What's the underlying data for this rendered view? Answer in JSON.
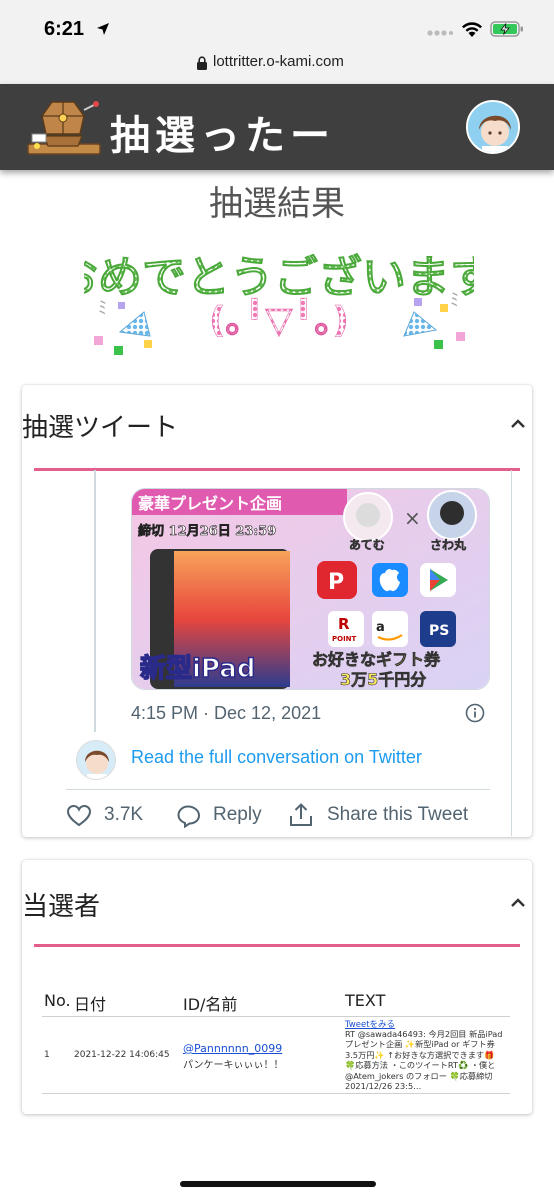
{
  "status_bar": {
    "time": "6:21"
  },
  "browser": {
    "url": "lottritter.o-kami.com"
  },
  "header": {
    "site_title": "抽選ったー"
  },
  "page": {
    "heading": "抽選結果",
    "congrats_text": "おめでとうございます"
  },
  "tweet_card": {
    "title": "抽選ツイート",
    "image": {
      "banner": "豪華プレゼント企画",
      "deadline": "締切 12月26日 23:59",
      "product": "新型iPad",
      "gift_line1": "お好きなギフト券",
      "gift_line2": "3万5千円分",
      "name_left": "あてむ",
      "name_right": "さわ丸",
      "point_label": "POINT"
    },
    "timestamp": "4:15 PM · Dec 12, 2021",
    "read_full": "Read the full conversation on Twitter",
    "like_count": "3.7K",
    "reply_label": "Reply",
    "share_label": "Share this Tweet"
  },
  "winners_card": {
    "title": "当選者",
    "columns": [
      "No.",
      "日付",
      "ID/名前",
      "TEXT"
    ],
    "rows": [
      {
        "no": "1",
        "date": "2021-12-22 14:06:45",
        "user_id": "@Pannnnnn_0099",
        "user_name": "パンケーキぃぃぃ！！",
        "tweet_link": "Tweetをみる",
        "text": "RT @sawada46493: 今月2回目 新品iPad\nプレゼント企画 ✨新型iPad or ギフト券\n3.5万円✨ ↑お好きな方選択できます🎁\n🍀応募方法 ・このツイートRT♻️ ・僕と\n@Atem_jokers のフォロー 🍀応募締切\n2021/12/26 23:5…"
      }
    ]
  },
  "colors": {
    "header_bg": "#3f3f3f",
    "accent_rule": "#e35d8d",
    "twitter_blue": "#1d9bf0",
    "link_blue": "#1a4fd6"
  }
}
